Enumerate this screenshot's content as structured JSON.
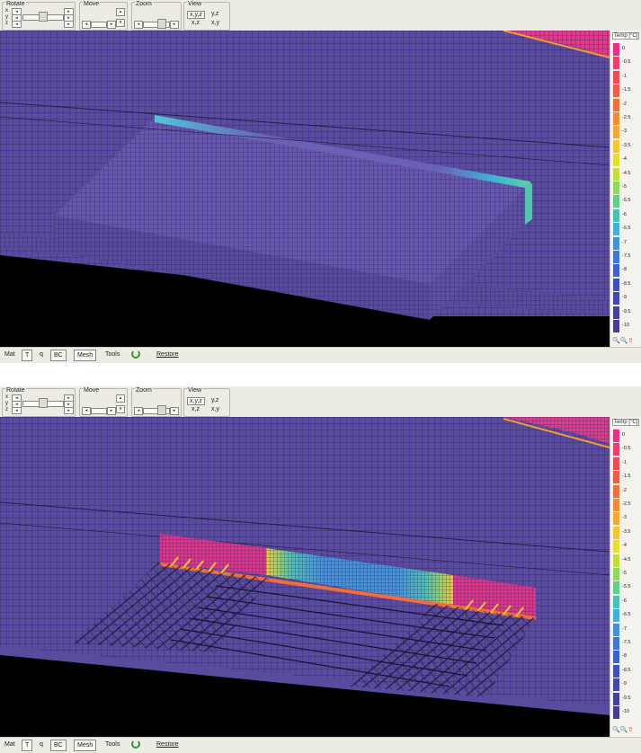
{
  "panels": [
    {
      "id": "top",
      "toolbar": {
        "rotate": {
          "title": "Rotate",
          "axes": [
            "x",
            "y",
            "z"
          ]
        },
        "move": {
          "title": "Move"
        },
        "zoom": {
          "title": "Zoom"
        },
        "view": {
          "title": "View",
          "buttons": [
            "x,y,z",
            "y,z",
            "x,z",
            "x,y"
          ],
          "selected": "x,y,z"
        }
      },
      "legend": {
        "title": "Temp [°C]",
        "values": [
          "0",
          "-0.5",
          "-1",
          "-1.5",
          "-2",
          "-2.5",
          "-3",
          "-3.5",
          "-4",
          "-4.5",
          "-5",
          "-5.5",
          "-6",
          "-6.5",
          "-7",
          "-7.5",
          "-8",
          "-8.5",
          "-9",
          "-9.5",
          "-10"
        ],
        "colors": [
          "#e8308a",
          "#ef3d6e",
          "#f04a56",
          "#f05b45",
          "#f26d3a",
          "#f58a33",
          "#f9a72f",
          "#f7c62c",
          "#e6dd2c",
          "#bfe03a",
          "#8fd85a",
          "#5fcf8a",
          "#45c3b5",
          "#3fb0d8",
          "#3d95e0",
          "#3c7ad9",
          "#3b63cf",
          "#3d52c2",
          "#4147b2",
          "#4640a2",
          "#4a3c92"
        ]
      },
      "bottombar": {
        "buttons": [
          "Mat",
          "T",
          "q",
          "BC",
          "Mesh",
          "Tools",
          "Restore"
        ],
        "selected": "T"
      }
    },
    {
      "id": "bottom",
      "toolbar": {
        "rotate": {
          "title": "Rotate",
          "axes": [
            "x",
            "y",
            "z"
          ]
        },
        "move": {
          "title": "Move"
        },
        "zoom": {
          "title": "Zoom"
        },
        "view": {
          "title": "View",
          "buttons": [
            "x,y,z",
            "y,z",
            "x,z",
            "x,y"
          ],
          "selected": "x,y,z"
        }
      },
      "legend": {
        "title": "Temp [°C]",
        "values": [
          "0",
          "-0.5",
          "-1",
          "-1.5",
          "-2",
          "-2.5",
          "-3",
          "-3.5",
          "-4",
          "-4.5",
          "-5",
          "-5.5",
          "-6",
          "-6.5",
          "-7",
          "-7.5",
          "-8",
          "-8.5",
          "-9",
          "-9.5",
          "-10"
        ],
        "colors": [
          "#e8308a",
          "#ef3d6e",
          "#f04a56",
          "#f05b45",
          "#f26d3a",
          "#f58a33",
          "#f9a72f",
          "#f7c62c",
          "#e6dd2c",
          "#bfe03a",
          "#8fd85a",
          "#5fcf8a",
          "#45c3b5",
          "#3fb0d8",
          "#3d95e0",
          "#3c7ad9",
          "#3b63cf",
          "#3d52c2",
          "#4147b2",
          "#4640a2",
          "#4a3c92"
        ]
      },
      "bottombar": {
        "buttons": [
          "Mat",
          "T",
          "q",
          "BC",
          "Mesh",
          "Tools",
          "Restore"
        ],
        "selected": "T"
      }
    }
  ],
  "colors": {
    "mesh_fill": "#5b4ba0",
    "mesh_line": "#2a2350",
    "ground": "#000000",
    "panel_bg": "#ecebe4"
  },
  "icons": {
    "refresh": "green-refresh-icon",
    "zoom_in": "zoom-in-icon",
    "zoom_out": "zoom-out-icon",
    "pan": "pan-arrow-icon"
  }
}
